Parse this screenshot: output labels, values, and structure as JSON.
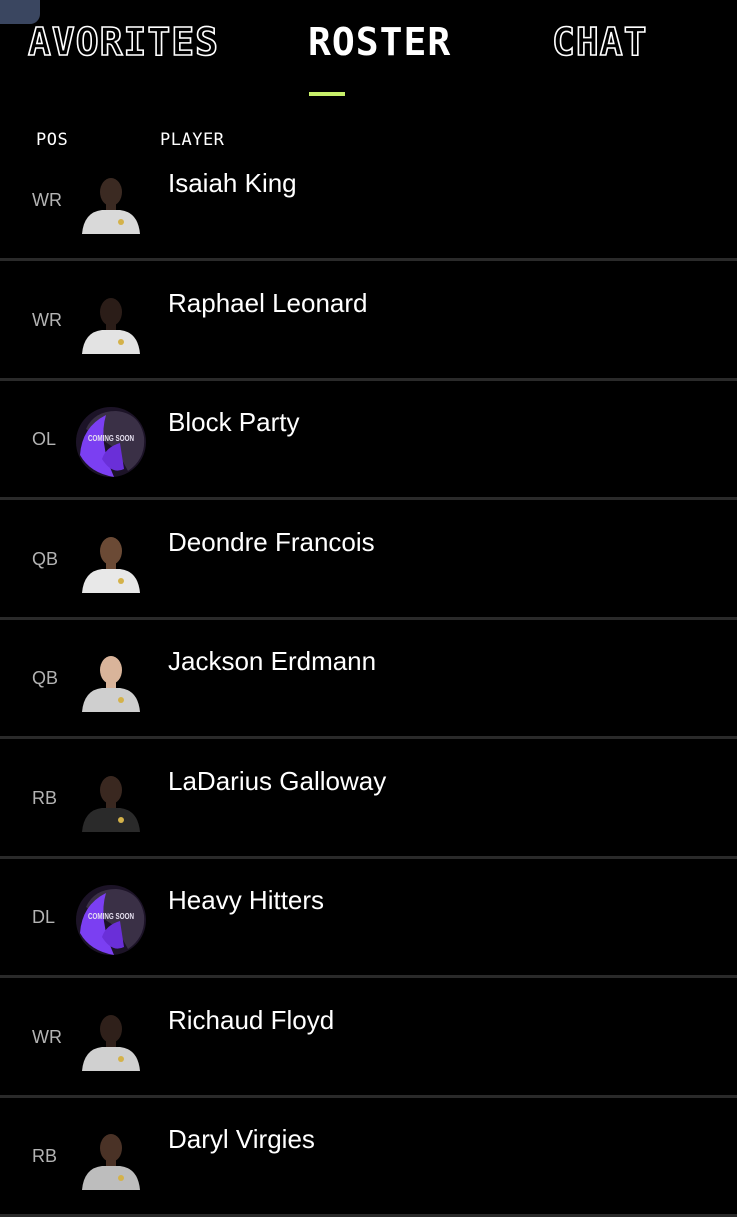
{
  "tabs": [
    {
      "label": "AVORITES",
      "active": false
    },
    {
      "label": "ROSTER",
      "active": true
    },
    {
      "label": "CHAT",
      "active": false
    }
  ],
  "columns": {
    "pos": "POS",
    "player": "PLAYER"
  },
  "accent_color": "#c8f06a",
  "roster": [
    {
      "pos": "WR",
      "name": "Isaiah King",
      "avatar": "player-photo",
      "hoodie": "#d9d9d9",
      "skin": "#3b2a22"
    },
    {
      "pos": "WR",
      "name": "Raphael Leonard",
      "avatar": "player-photo",
      "hoodie": "#e3e3e3",
      "skin": "#2b1d18"
    },
    {
      "pos": "OL",
      "name": "Block Party",
      "avatar": "coming-soon-badge",
      "badge_text": "COMING SOON"
    },
    {
      "pos": "QB",
      "name": "Deondre Francois",
      "avatar": "player-photo",
      "hoodie": "#e8e8e8",
      "skin": "#6b4a35"
    },
    {
      "pos": "QB",
      "name": "Jackson Erdmann",
      "avatar": "player-photo",
      "hoodie": "#cfcfcf",
      "skin": "#d9b49a"
    },
    {
      "pos": "RB",
      "name": "LaDarius Galloway",
      "avatar": "player-photo",
      "hoodie": "#2a2a2a",
      "skin": "#3a2820"
    },
    {
      "pos": "DL",
      "name": "Heavy Hitters",
      "avatar": "coming-soon-badge",
      "badge_text": "COMING SOON"
    },
    {
      "pos": "WR",
      "name": "Richaud Floyd",
      "avatar": "player-photo",
      "hoodie": "#d0d0d0",
      "skin": "#2f201a"
    },
    {
      "pos": "RB",
      "name": "Daryl Virgies",
      "avatar": "player-photo",
      "hoodie": "#bdbdbd",
      "skin": "#4a3226"
    }
  ]
}
